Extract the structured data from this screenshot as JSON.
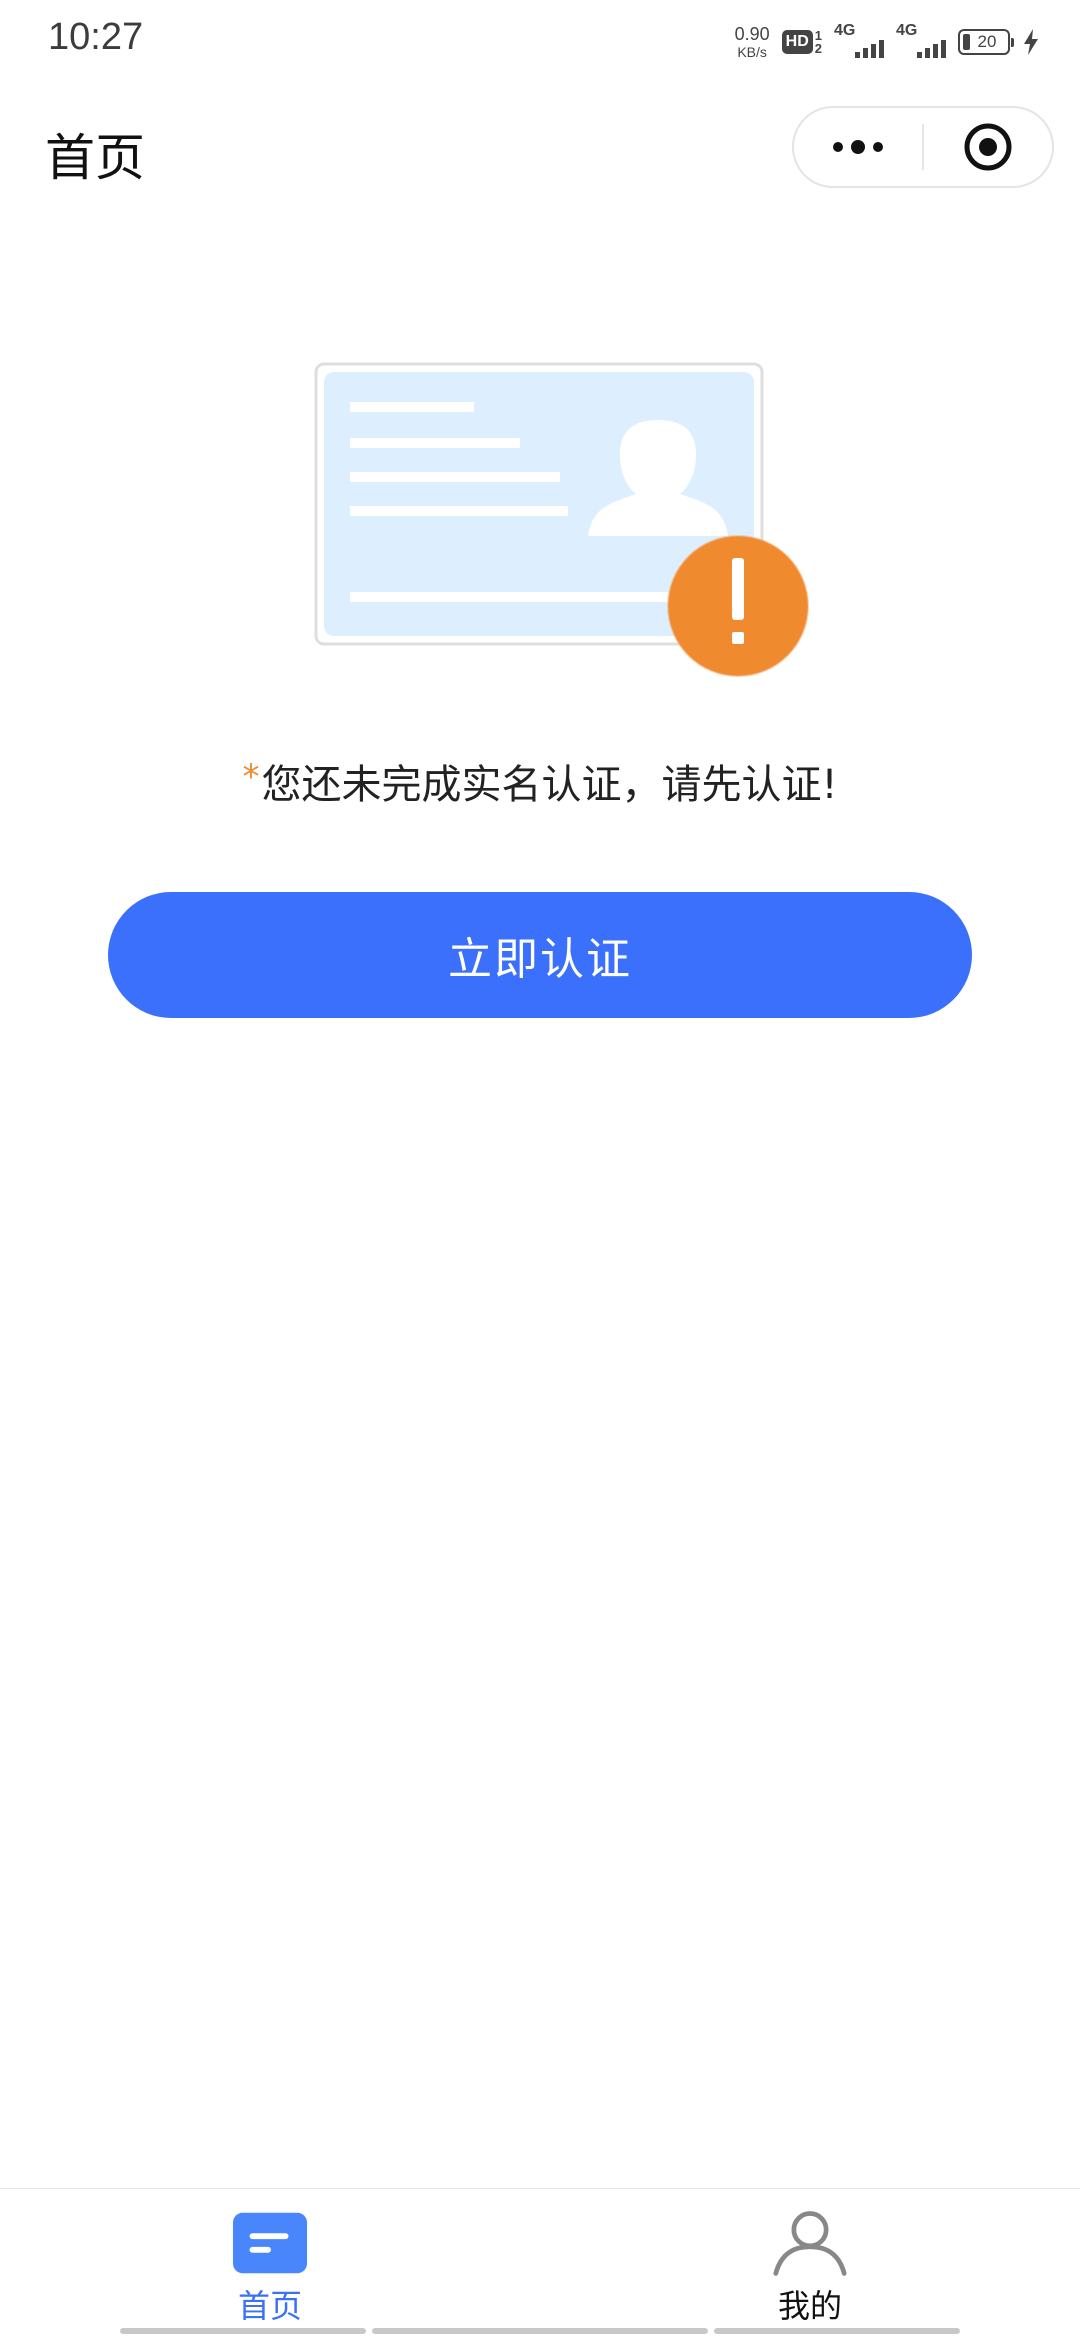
{
  "status_bar": {
    "time": "10:27",
    "net_speed_value": "0.90",
    "net_speed_unit": "KB/s",
    "hd_label": "HD",
    "hd_sim_top": "1",
    "hd_sim_bottom": "2",
    "sim1_label": "4G",
    "sim2_label": "4G",
    "battery_percent": "20",
    "charging": true
  },
  "nav": {
    "title": "首页",
    "more_icon": "more-dots-icon",
    "close_icon": "target-circle-icon"
  },
  "main": {
    "illustration_icon": "id-card-warning-icon",
    "notice_required_mark": "*",
    "notice_text": "您还未完成实名认证，请先认证!",
    "verify_button_label": "立即认证"
  },
  "tab_bar": {
    "tabs": [
      {
        "label": "首页",
        "icon": "home-doc-icon",
        "active": true
      },
      {
        "label": "我的",
        "icon": "person-icon",
        "active": false
      }
    ]
  },
  "colors": {
    "accent": "#3a70fb",
    "warning": "#f08a2e",
    "card_bg": "#ddefff"
  }
}
